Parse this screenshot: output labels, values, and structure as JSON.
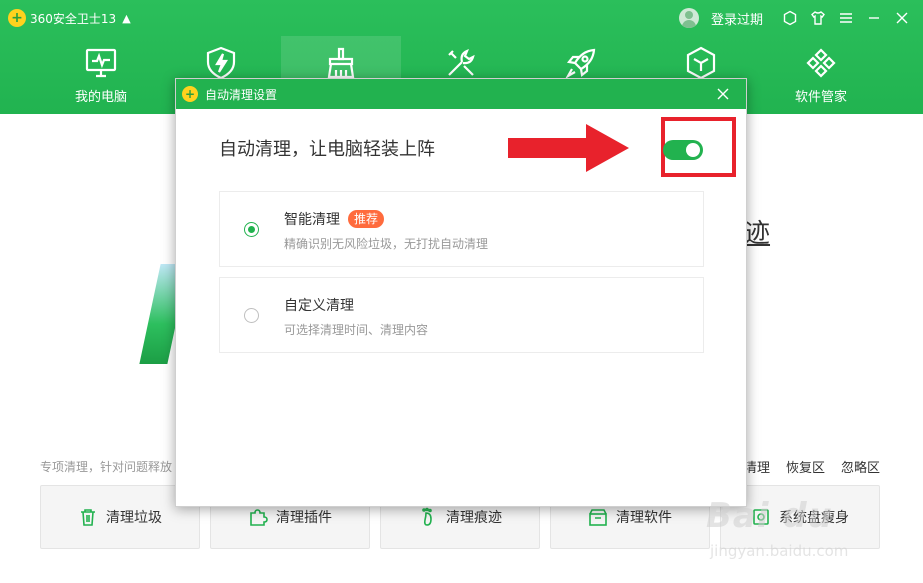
{
  "app": {
    "title": "360安全卫士13",
    "logo_glyph": "+",
    "login_text": "登录过期",
    "accent_color": "#22b24f"
  },
  "nav": {
    "items": [
      {
        "label": "我的电脑",
        "icon": "monitor-icon"
      },
      {
        "label": "",
        "icon": "shield-bolt-icon"
      },
      {
        "label": "",
        "icon": "broom-icon",
        "active": true
      },
      {
        "label": "",
        "icon": "tools-icon"
      },
      {
        "label": "",
        "icon": "rocket-icon"
      },
      {
        "label": "",
        "icon": "cube-icon"
      },
      {
        "label": "软件管家",
        "icon": "apps-icon"
      }
    ]
  },
  "background": {
    "heading_fragment": "迹",
    "special_label": "专项清理，针对问题释放",
    "quick_links": [
      "清理",
      "恢复区",
      "忽略区"
    ],
    "tools": [
      {
        "label": "清理垃圾",
        "icon": "trash-icon"
      },
      {
        "label": "清理插件",
        "icon": "puzzle-icon"
      },
      {
        "label": "清理痕迹",
        "icon": "footprint-icon"
      },
      {
        "label": "清理软件",
        "icon": "box-icon"
      },
      {
        "label": "系统盘瘦身",
        "icon": "disk-icon"
      }
    ]
  },
  "dialog": {
    "title": "自动清理设置",
    "auto_label": "自动清理，让电脑轻装上阵",
    "auto_enabled": true,
    "options": [
      {
        "title": "智能清理",
        "badge": "推荐",
        "desc": "精确识别无风险垃圾，无打扰自动清理",
        "selected": true
      },
      {
        "title": "自定义清理",
        "badge": "",
        "desc": "可选择清理时间、清理内容",
        "selected": false
      }
    ]
  },
  "annotation": {
    "color": "#e8222c"
  },
  "watermark": {
    "main": "Bai du",
    "sub": "jingyan.baidu.com"
  }
}
